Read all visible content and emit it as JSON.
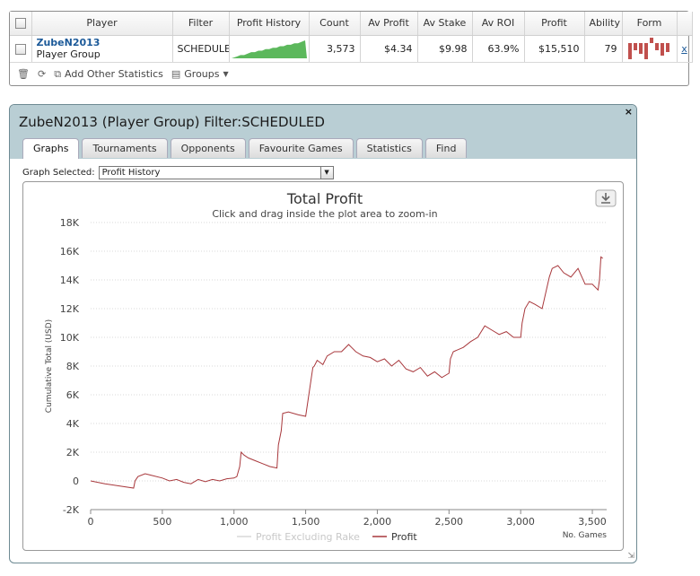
{
  "stats_table": {
    "headers": {
      "player": "Player",
      "filter": "Filter",
      "profit_history": "Profit History",
      "count": "Count",
      "av_profit": "Av Profit",
      "av_stake": "Av Stake",
      "av_roi": "Av ROI",
      "profit": "Profit",
      "ability": "Ability",
      "form": "Form"
    },
    "row": {
      "player_name": "ZubeN2013",
      "player_type": "Player Group",
      "filter": "SCHEDULED",
      "count": "3,573",
      "av_profit": "$4.34",
      "av_stake": "$9.98",
      "av_roi": "63.9%",
      "profit": "$15,510",
      "ability": "79",
      "remove_label": "x",
      "sparkline": [
        0,
        1,
        1,
        2,
        3,
        3,
        4,
        4,
        5,
        5,
        6,
        6,
        7,
        7,
        8,
        8,
        9,
        9,
        10,
        11
      ],
      "form_bars": [
        -18,
        -8,
        -12,
        -22,
        6,
        -8,
        -14,
        -10
      ]
    },
    "toolbar": {
      "add_stats_label": "Add Other Statistics",
      "groups_label": "Groups"
    }
  },
  "dialog": {
    "title": "ZubeN2013 (Player Group) Filter:SCHEDULED",
    "close_label": "×",
    "tabs": [
      "Graphs",
      "Tournaments",
      "Opponents",
      "Favourite Games",
      "Statistics",
      "Find"
    ],
    "active_tab": "Graphs",
    "graph_selected_label": "Graph Selected:",
    "graph_selected_value": "Profit History"
  },
  "colors": {
    "header_bg": "#b9ced4",
    "profit_line": "#a8383c",
    "rake_line": "#d8d8d8",
    "sparkline": "#5cb85c",
    "form_bar": "#c0504d",
    "link": "#1c5a99"
  },
  "chart_data": {
    "type": "line",
    "title": "Total Profit",
    "subtitle": "Click and drag inside the plot area to zoom-in",
    "ylabel": "Cumulative Total (USD)",
    "xlabel": "No. Games",
    "xlim": [
      0,
      3600
    ],
    "ylim": [
      -2000,
      18000
    ],
    "xticks": [
      0,
      500,
      1000,
      1500,
      2000,
      2500,
      3000,
      3500
    ],
    "yticks": [
      -2000,
      0,
      2000,
      4000,
      6000,
      8000,
      10000,
      12000,
      14000,
      16000,
      18000
    ],
    "xtick_labels": [
      "0",
      "500",
      "1,000",
      "1,500",
      "2,000",
      "2,500",
      "3,000",
      "3,500"
    ],
    "ytick_labels": [
      "-2K",
      "0",
      "2K",
      "4K",
      "6K",
      "8K",
      "10K",
      "12K",
      "14K",
      "16K",
      "18K"
    ],
    "grid": true,
    "legend_placement": "bottom-center",
    "series": [
      {
        "name": "Profit",
        "color": "#a8383c",
        "x": [
          0,
          100,
          200,
          300,
          310,
          330,
          380,
          420,
          500,
          550,
          600,
          650,
          700,
          750,
          800,
          850,
          900,
          950,
          1000,
          1020,
          1040,
          1050,
          1070,
          1100,
          1150,
          1200,
          1250,
          1300,
          1310,
          1330,
          1340,
          1380,
          1450,
          1500,
          1550,
          1560,
          1580,
          1620,
          1650,
          1700,
          1750,
          1800,
          1820,
          1850,
          1900,
          1950,
          2000,
          2050,
          2100,
          2150,
          2200,
          2250,
          2300,
          2350,
          2400,
          2450,
          2500,
          2510,
          2530,
          2600,
          2650,
          2700,
          2750,
          2800,
          2850,
          2900,
          2950,
          3000,
          3010,
          3030,
          3060,
          3100,
          3150,
          3200,
          3220,
          3260,
          3300,
          3350,
          3400,
          3450,
          3500,
          3540,
          3550,
          3560,
          3573
        ],
        "y": [
          0,
          -200,
          -350,
          -500,
          0,
          300,
          500,
          400,
          200,
          0,
          100,
          -100,
          -200,
          100,
          -50,
          100,
          0,
          150,
          200,
          300,
          1000,
          2000,
          1800,
          1600,
          1400,
          1200,
          1000,
          900,
          2500,
          3500,
          4700,
          4800,
          4600,
          4500,
          7900,
          8000,
          8400,
          8100,
          8700,
          9000,
          9000,
          9500,
          9300,
          9000,
          8700,
          8600,
          8300,
          8500,
          8000,
          8400,
          7800,
          7600,
          7900,
          7300,
          7600,
          7200,
          7500,
          8500,
          9000,
          9300,
          9700,
          10000,
          10800,
          10500,
          10200,
          10400,
          10000,
          10000,
          11000,
          12000,
          12500,
          12300,
          12000,
          14200,
          14800,
          15000,
          14500,
          14200,
          14800,
          13700,
          13700,
          13300,
          14000,
          15600,
          15500
        ]
      },
      {
        "name": "Profit Excluding Rake",
        "color": "#d8d8d8",
        "hidden": true
      }
    ]
  }
}
